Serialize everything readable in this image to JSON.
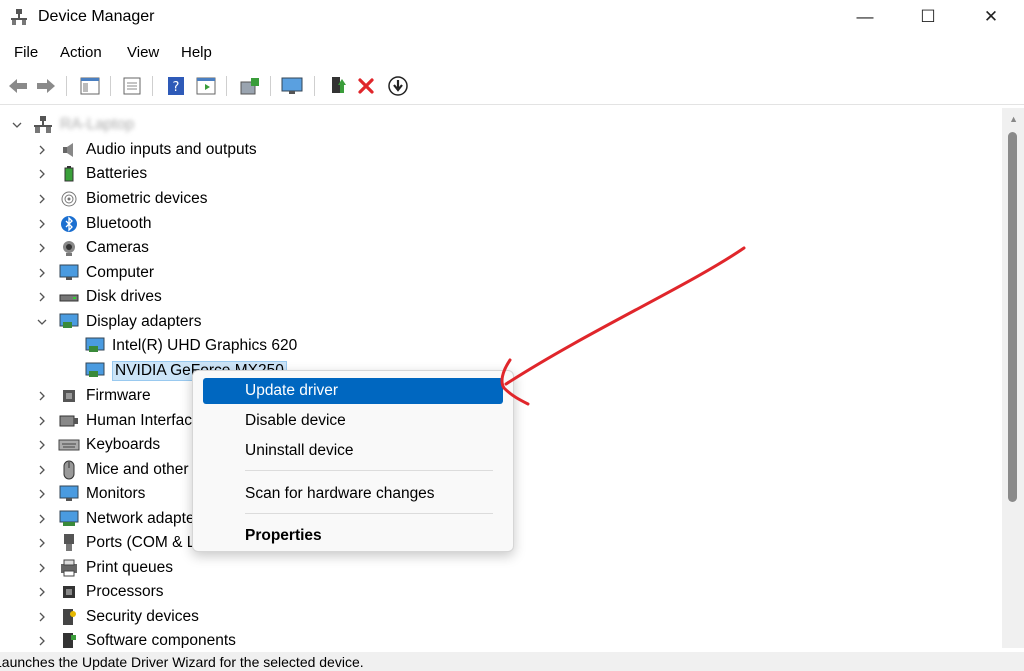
{
  "window": {
    "title": "Device Manager",
    "minimize_glyph": "—",
    "maximize_glyph": "☐",
    "close_glyph": "✕"
  },
  "menu": [
    "File",
    "Action",
    "View",
    "Help"
  ],
  "tree": {
    "root_label": "RA-Laptop",
    "categories": [
      {
        "label": "Audio inputs and outputs",
        "icon": "speaker-icon"
      },
      {
        "label": "Batteries",
        "icon": "battery-icon"
      },
      {
        "label": "Biometric devices",
        "icon": "fingerprint-icon"
      },
      {
        "label": "Bluetooth",
        "icon": "bluetooth-icon"
      },
      {
        "label": "Cameras",
        "icon": "camera-icon"
      },
      {
        "label": "Computer",
        "icon": "monitor-icon"
      },
      {
        "label": "Disk drives",
        "icon": "disk-drive-icon"
      },
      {
        "label": "Display adapters",
        "icon": "display-adapter-icon"
      },
      {
        "label": "Intel(R) UHD Graphics 620",
        "icon": "display-adapter-icon"
      },
      {
        "label": "NVIDIA GeForce MX250",
        "icon": "display-adapter-icon"
      },
      {
        "label": "Firmware",
        "icon": "chip-icon"
      },
      {
        "label": "Human Interface Devices",
        "icon": "hid-icon"
      },
      {
        "label": "Keyboards",
        "icon": "keyboard-icon"
      },
      {
        "label": "Mice and other pointing devices",
        "icon": "mouse-icon"
      },
      {
        "label": "Monitors",
        "icon": "monitor-icon"
      },
      {
        "label": "Network adapters",
        "icon": "network-icon"
      },
      {
        "label": "Ports (COM & LPT)",
        "icon": "port-icon"
      },
      {
        "label": "Print queues",
        "icon": "printer-icon"
      },
      {
        "label": "Processors",
        "icon": "processor-icon"
      },
      {
        "label": "Security devices",
        "icon": "security-icon"
      },
      {
        "label": "Software components",
        "icon": "software-icon"
      }
    ]
  },
  "context_menu": {
    "update_driver": "Update driver",
    "disable_device": "Disable device",
    "uninstall_device": "Uninstall device",
    "scan_hardware": "Scan for hardware changes",
    "properties": "Properties"
  },
  "status": {
    "text": "Launches the Update Driver Wizard for the selected device."
  },
  "colors": {
    "highlight": "#0067c0",
    "annotation_arrow": "#e0262b",
    "selection": "#cce4f7"
  }
}
